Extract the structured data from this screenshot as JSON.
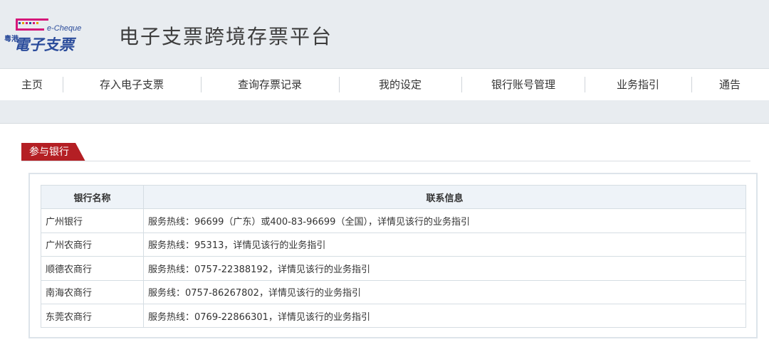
{
  "header": {
    "logo_side_text": "粵港",
    "logo_text": "電子支票",
    "logo_en": "e-Cheque",
    "title": "电子支票跨境存票平台"
  },
  "nav": {
    "items": [
      {
        "label": "主页"
      },
      {
        "label": "存入电子支票"
      },
      {
        "label": "查询存票记录"
      },
      {
        "label": "我的设定"
      },
      {
        "label": "银行账号管理"
      },
      {
        "label": "业务指引"
      },
      {
        "label": "通告"
      }
    ]
  },
  "section": {
    "title": "参与银行"
  },
  "table": {
    "headers": [
      "银行名称",
      "联系信息"
    ],
    "rows": [
      {
        "bank": "广州银行",
        "contact": "服务热线：96699（广东）或400-83-96699（全国），详情见该行的业务指引"
      },
      {
        "bank": "广州农商行",
        "contact": "服务热线：95313，详情见该行的业务指引"
      },
      {
        "bank": "顺德农商行",
        "contact": "服务热线：0757-22388192，详情见该行的业务指引"
      },
      {
        "bank": "南海农商行",
        "contact": "服务线：0757-86267802，详情见该行的业务指引"
      },
      {
        "bank": "东莞农商行",
        "contact": "服务热线：0769-22866301，详情见该行的业务指引"
      }
    ]
  },
  "colors": {
    "header_bg": "#e8ecf0",
    "accent_red": "#b41f24",
    "logo_blue": "#2b4c9b",
    "logo_magenta": "#d5177a"
  }
}
